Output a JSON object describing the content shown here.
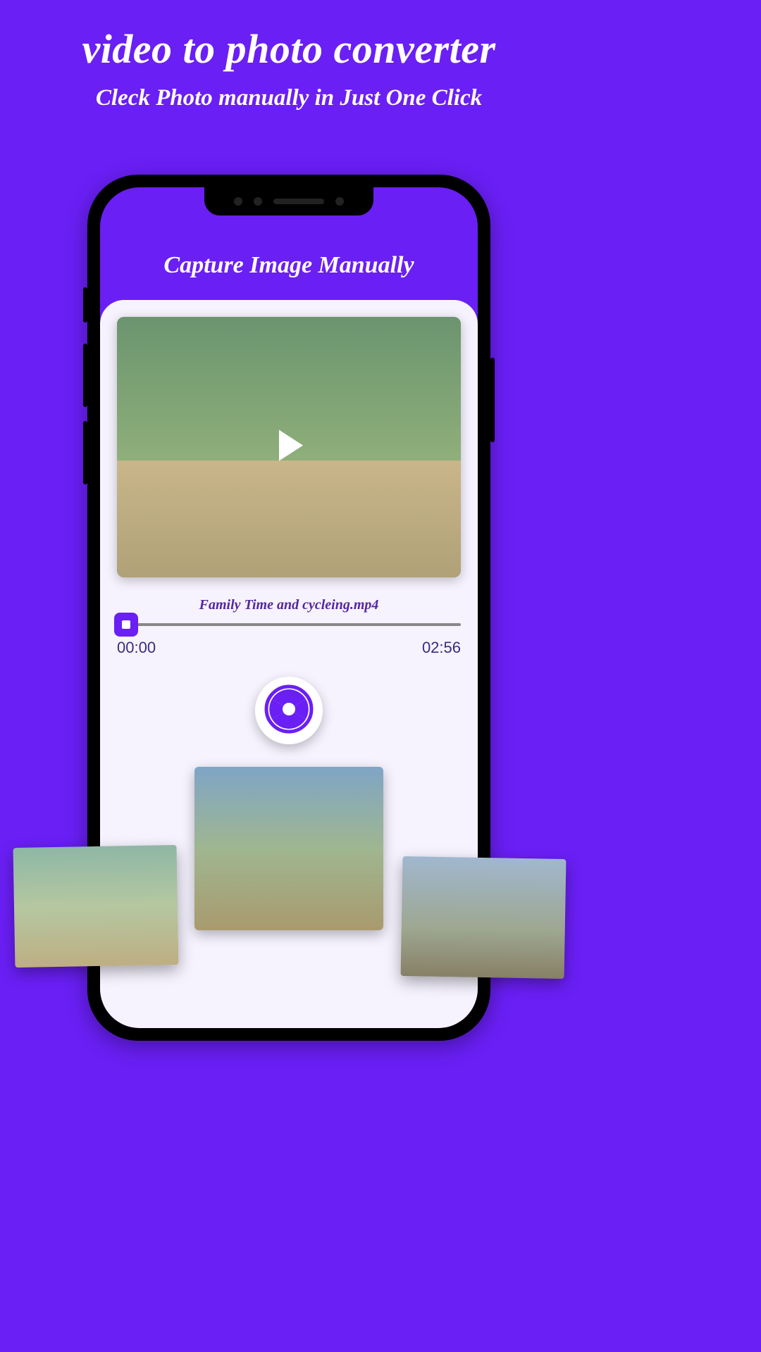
{
  "hero": {
    "title": "video to photo converter",
    "subtitle": "Cleck Photo manually in Just One Click"
  },
  "screen": {
    "title": "Capture Image Manually",
    "filename": "Family Time and cycleing.mp4",
    "time_current": "00:00",
    "time_total": "02:56"
  }
}
